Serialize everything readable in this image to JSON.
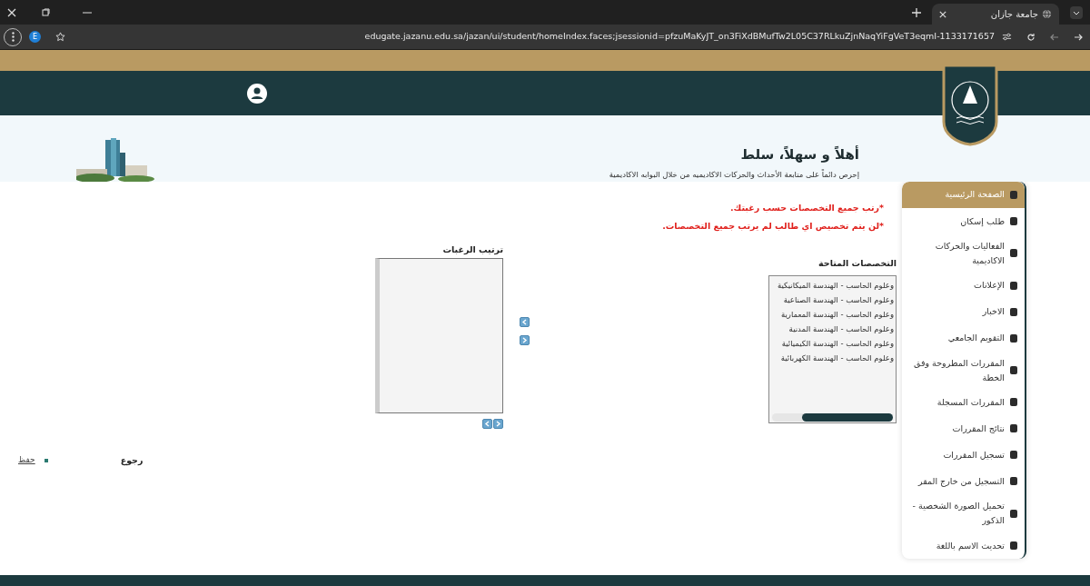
{
  "browser": {
    "tab_title": "جامعة جازان",
    "profile_letter": "E",
    "url": "edugate.jazanu.edu.sa/jazan/ui/student/homeIndex.faces;jsessionid=pfzuMaKyJT_on3FiXdBMufTw2L05C37RLkuZjnNaqYiFgVeT3eqmI-1133171657"
  },
  "welcome": {
    "title": "أهلاً و سهلاً، سلط",
    "subtitle": "إحرص دائماً على متابعة الأحداث والحركات الاكاديميه من خلال البوابه الاكاديمية"
  },
  "sidebar": {
    "items": [
      {
        "label": "الصفحة الرئيسية",
        "selected": true
      },
      {
        "label": "طلب إسكان",
        "selected": false
      },
      {
        "label": "الفعاليات والحركات الاكاديمية",
        "selected": false
      },
      {
        "label": "الإعلانات",
        "selected": false
      },
      {
        "label": "الاخبار",
        "selected": false
      },
      {
        "label": "التقويم الجامعي",
        "selected": false
      },
      {
        "label": "المقررات المطروحة وفق الخطة",
        "selected": false
      },
      {
        "label": "المقررات المسجلة",
        "selected": false
      },
      {
        "label": "نتائج المقررات",
        "selected": false
      },
      {
        "label": "تسجيل المقررات",
        "selected": false
      },
      {
        "label": "التسجيل من خارج المقر",
        "selected": false
      },
      {
        "label": "تحميل الصورة الشخصية - الذكور",
        "selected": false
      },
      {
        "label": "تحديث الاسم باللغة",
        "selected": false
      }
    ]
  },
  "notes": [
    "*رتب جميع التخصصات حسب رغبتك.",
    "*لن يتم تخصيص اي طالب لم يرتب جميع التخصصات."
  ],
  "available": {
    "heading": "التخصصات المتاحة",
    "items": [
      "وعلوم الحاسب - الهندسة الميكانيكية",
      "وعلوم الحاسب - الهندسة الصناعية",
      "وعلوم الحاسب - الهندسة المعمارية",
      "وعلوم الحاسب - الهندسة المدنية",
      "وعلوم الحاسب - الهندسة الكيميائية",
      "وعلوم الحاسب - الهندسة الكهربائية"
    ]
  },
  "preferences": {
    "heading": "ترتيب الرغبات"
  },
  "actions": {
    "back": "رجوع",
    "save": "حفظ"
  }
}
